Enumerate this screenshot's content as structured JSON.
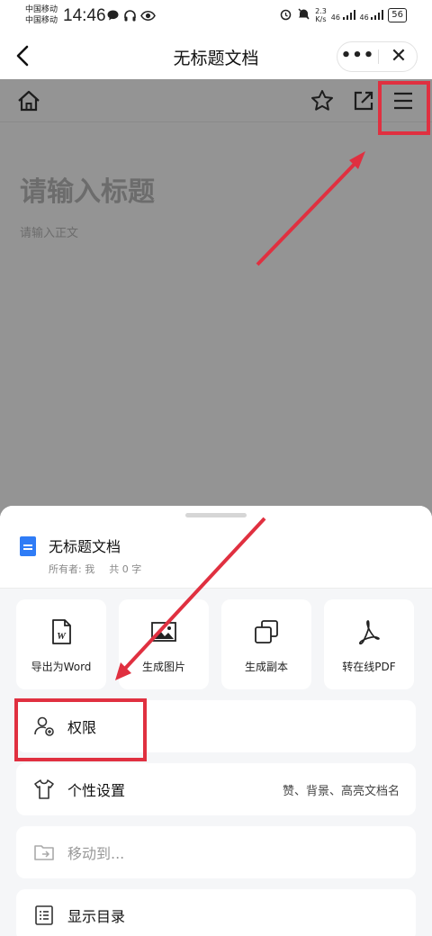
{
  "status_bar": {
    "carrier1": "中国移动",
    "carrier2": "中国移动",
    "time": "14:46",
    "net_speed_top": "2.3",
    "net_speed_bottom": "K/s",
    "signal1": "46",
    "signal2": "46",
    "battery": "56"
  },
  "header": {
    "title": "无标题文档",
    "more_label": "•••",
    "close_label": "✕"
  },
  "document": {
    "title_placeholder": "请输入标题",
    "body_placeholder": "请输入正文"
  },
  "sheet": {
    "doc_name": "无标题文档",
    "owner": "所有者: 我",
    "word_count": "共 0 字",
    "tiles": [
      {
        "label": "导出为Word",
        "icon": "word-doc-icon"
      },
      {
        "label": "生成图片",
        "icon": "image-icon"
      },
      {
        "label": "生成副本",
        "icon": "copy-icon"
      },
      {
        "label": "转在线PDF",
        "icon": "pdf-icon"
      }
    ],
    "menu": [
      {
        "label": "权限",
        "icon": "user-permission-icon",
        "hint": ""
      },
      {
        "label": "个性设置",
        "icon": "shirt-icon",
        "hint": "赞、背景、高亮文档名"
      },
      {
        "label": "移动到...",
        "icon": "folder-move-icon",
        "hint": ""
      },
      {
        "label": "显示目录",
        "icon": "toc-icon",
        "hint": ""
      }
    ]
  },
  "colors": {
    "accent": "#2f7cf6",
    "annotation": "#e03040",
    "overlay": "rgba(0,0,0,0.42)",
    "sheet_bg": "#f5f6f8"
  }
}
